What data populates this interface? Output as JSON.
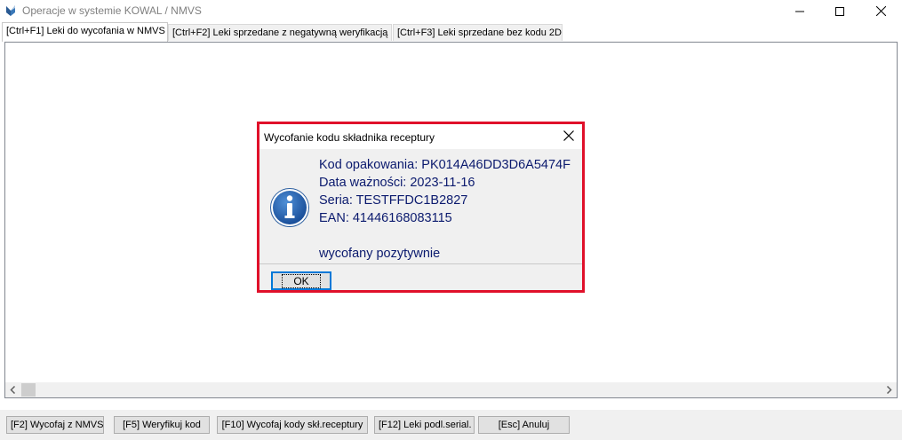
{
  "window": {
    "title": "Operacje w systemie KOWAL / NMVS"
  },
  "tabs": [
    {
      "label": "[Ctrl+F1] Leki do wycofania w NMVS",
      "active": true
    },
    {
      "label": "[Ctrl+F2] Leki sprzedane z negatywną weryfikacją",
      "active": false
    },
    {
      "label": "[Ctrl+F3] Leki sprzedane bez kodu 2D",
      "active": false
    }
  ],
  "dialog": {
    "title": "Wycofanie kodu składnika receptury",
    "lines": {
      "package_code": "Kod opakowania: PK014A46DD3D6A5474F",
      "expiry": "Data ważności: 2023-11-16",
      "series": "Seria: TESTFFDC1B2827",
      "ean": "EAN: 41446168083115",
      "status": "wycofany pozytywnie"
    },
    "ok_label": "OK",
    "icon": "info-icon",
    "highlight_color": "#e0102a"
  },
  "toolbar": {
    "buttons": [
      {
        "label": "[F2] Wycofaj z NMVS"
      },
      {
        "label": "[F5] Weryfikuj kod"
      },
      {
        "label": "[F10] Wycofaj kody skł.receptury"
      },
      {
        "label": "[F12] Leki podl.serial."
      },
      {
        "label": "[Esc] Anuluj"
      }
    ]
  },
  "colors": {
    "message_text": "#0b1a6e",
    "accent": "#0078d7"
  }
}
